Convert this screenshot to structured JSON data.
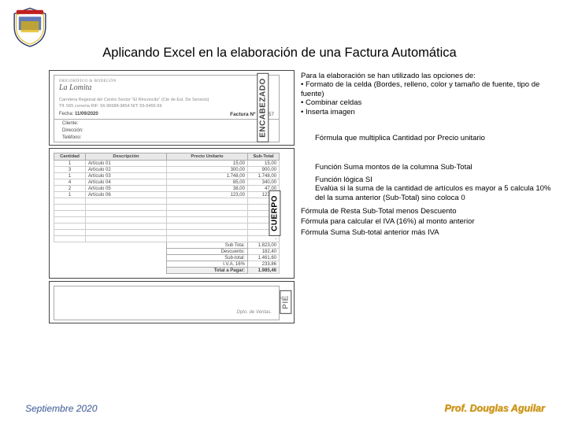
{
  "title": "Aplicando Excel en la elaboración de una Factura Automática",
  "labels": {
    "enc": "ENCABEZADO",
    "cuerpo": "CUERPO",
    "pie": "PIÉ"
  },
  "enc": {
    "brand": "La Lomita",
    "brand_tag": "FRIGORÍFICO & BODEGÓN",
    "addr": "Carretera Regional del Centro Sector \"El Rinconcito\" (Cte de Est. De Servicio)",
    "tel": "Tlf. 565 correría  RIF: 56-96588-9854  NIT: 55-6455-59",
    "fecha_lab": "Fecha:",
    "fecha_val": "11/09/2020",
    "factura_lab": "Factura Nº",
    "factura_num": "198457",
    "cliente": "Cliente:",
    "direccion": "Dirección:",
    "telefono": "Teléfono:"
  },
  "headers": [
    "Cantidad",
    "Descripción",
    "Precio Unitario",
    "Sub-Total"
  ],
  "rows": [
    {
      "c": "1",
      "d": "Artículo 01",
      "p": "15,00",
      "s": "15,00"
    },
    {
      "c": "3",
      "d": "Artículo 02",
      "p": "300,00",
      "s": "900,00"
    },
    {
      "c": "1",
      "d": "Artículo 03",
      "p": "1.748,00",
      "s": "1.748,00"
    },
    {
      "c": "4",
      "d": "Artículo 04",
      "p": "85,00",
      "s": "340,00"
    },
    {
      "c": "2",
      "d": "Artículo 05",
      "p": "38,00",
      "s": "47,00"
    },
    {
      "c": "1",
      "d": "Artículo 06",
      "p": "123,00",
      "s": "123,00"
    }
  ],
  "totals": {
    "subtot_lab": "Sub Tota:",
    "subtot": "1.823,00",
    "desc_lab": "Descuento:",
    "desc": "182,40",
    "subiva_lab": "Sub-total:",
    "subiva": "1.461,60",
    "iva_lab": "I.V.A. 16%",
    "iva": "233,86",
    "total_lab": "Total a Pagar:",
    "total": "1.985,46"
  },
  "pie_text": "Dpto. de Ventas.",
  "notes": {
    "intro": "Para la elaboración se han utilizado las opciones de:",
    "b1": "• Formato de la celda (Bordes, relleno, color y tamaño de fuente, tipo de fuente)",
    "b2": "• Combinar celdas",
    "b3": "• Inserta imagen",
    "formula1": "Fórmula que multiplica Cantidad por Precio unitario",
    "fnsuma": "Función Suma montos de la columna Sub-Total",
    "fnsi1": "Función lógica SI",
    "fnsi2": "Evalúa si la suma de la cantidad de artículos es mayor a 5 calcula 10% del la suma anterior (Sub-Total) sino coloca 0",
    "resta": "Fórmula de Resta Sub-Total menos Descuento",
    "iva": "Fórmula para calcular el IVA (16%) al monto anterior",
    "final": "Fórmula Suma Sub-total anterior más IVA"
  },
  "footer_left": "Septiembre 2020",
  "footer_right": "Prof. Douglas Aguilar"
}
